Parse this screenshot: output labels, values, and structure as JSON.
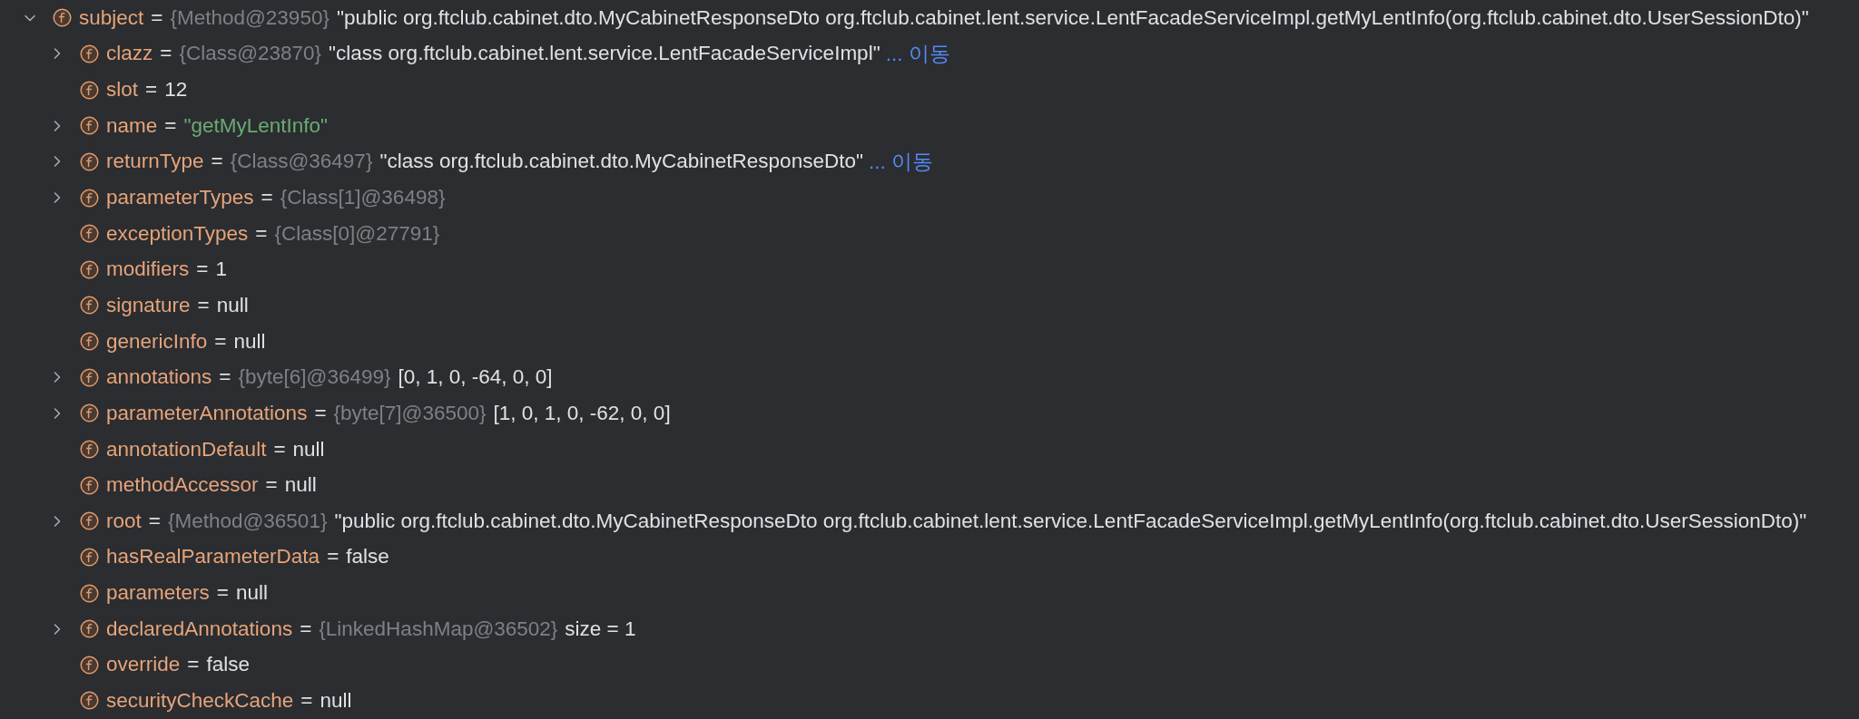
{
  "variables": [
    {
      "name": "subject",
      "separator": "=",
      "type": "{Method@23950}",
      "value": "\"public org.ftclub.cabinet.dto.MyCabinetResponseDto org.ftclub.cabinet.lent.service.LentFacadeServiceImpl.getMyLentInfo(org.ftclub.cabinet.dto.UserSessionDto)\"",
      "kind": "text",
      "expanded": true,
      "children": [
        {
          "name": "clazz",
          "separator": "=",
          "type": "{Class@23870}",
          "value": "\"class org.ftclub.cabinet.lent.service.LentFacadeServiceImpl\"",
          "kind": "text",
          "link": "... 이동",
          "expanded": false
        },
        {
          "name": "slot",
          "separator": "=",
          "value": "12",
          "kind": "text"
        },
        {
          "name": "name",
          "separator": "=",
          "value": "\"getMyLentInfo\"",
          "kind": "string",
          "expanded": false
        },
        {
          "name": "returnType",
          "separator": "=",
          "type": "{Class@36497}",
          "value": "\"class org.ftclub.cabinet.dto.MyCabinetResponseDto\"",
          "kind": "text",
          "link": "... 이동",
          "expanded": false
        },
        {
          "name": "parameterTypes",
          "separator": "=",
          "type": "{Class[1]@36498}",
          "expanded": false
        },
        {
          "name": "exceptionTypes",
          "separator": "=",
          "type": "{Class[0]@27791}"
        },
        {
          "name": "modifiers",
          "separator": "=",
          "value": "1",
          "kind": "text"
        },
        {
          "name": "signature",
          "separator": "=",
          "value": "null",
          "kind": "text"
        },
        {
          "name": "genericInfo",
          "separator": "=",
          "value": "null",
          "kind": "text"
        },
        {
          "name": "annotations",
          "separator": "=",
          "type": "{byte[6]@36499}",
          "value": "[0, 1, 0, -64, 0, 0]",
          "kind": "text",
          "expanded": false
        },
        {
          "name": "parameterAnnotations",
          "separator": "=",
          "type": "{byte[7]@36500}",
          "value": "[1, 0, 1, 0, -62, 0, 0]",
          "kind": "text",
          "expanded": false
        },
        {
          "name": "annotationDefault",
          "separator": "=",
          "value": "null",
          "kind": "text"
        },
        {
          "name": "methodAccessor",
          "separator": "=",
          "value": "null",
          "kind": "text"
        },
        {
          "name": "root",
          "separator": "=",
          "type": "{Method@36501}",
          "value": "\"public org.ftclub.cabinet.dto.MyCabinetResponseDto org.ftclub.cabinet.lent.service.LentFacadeServiceImpl.getMyLentInfo(org.ftclub.cabinet.dto.UserSessionDto)\"",
          "kind": "text",
          "expanded": false
        },
        {
          "name": "hasRealParameterData",
          "separator": "=",
          "value": "false",
          "kind": "text"
        },
        {
          "name": "parameters",
          "separator": "=",
          "value": "null",
          "kind": "text"
        },
        {
          "name": "declaredAnnotations",
          "separator": "=",
          "type": "{LinkedHashMap@36502}",
          "value": "size = 1",
          "kind": "text",
          "expanded": false
        },
        {
          "name": "override",
          "separator": "=",
          "value": "false",
          "kind": "text"
        },
        {
          "name": "securityCheckCache",
          "separator": "=",
          "value": "null",
          "kind": "text"
        }
      ]
    }
  ]
}
